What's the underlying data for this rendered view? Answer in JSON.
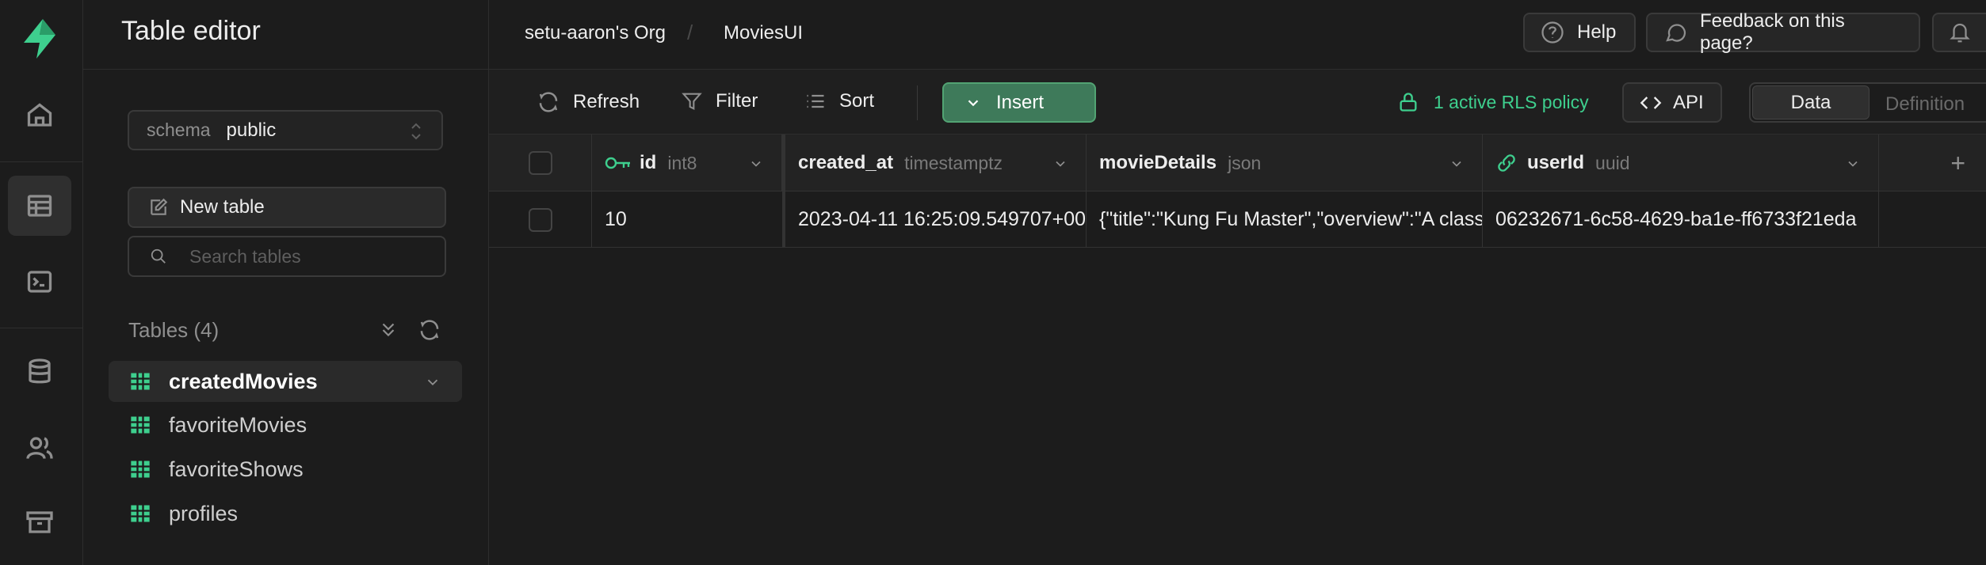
{
  "sidebar": {
    "title": "Table editor",
    "schema_label": "schema",
    "schema_value": "public",
    "new_table_label": "New table",
    "search_placeholder": "Search tables",
    "tables_header": "Tables (4)",
    "tables": [
      {
        "name": "createdMovies",
        "active": true
      },
      {
        "name": "favoriteMovies",
        "active": false
      },
      {
        "name": "favoriteShows",
        "active": false
      },
      {
        "name": "profiles",
        "active": false
      }
    ]
  },
  "header": {
    "org": "setu-aaron's Org",
    "separator": "/",
    "project": "MoviesUI",
    "help_label": "Help",
    "feedback_label": "Feedback on this page?"
  },
  "toolbar": {
    "refresh_label": "Refresh",
    "filter_label": "Filter",
    "sort_label": "Sort",
    "insert_label": "Insert",
    "rls_label": "1 active RLS policy",
    "api_label": "API",
    "view_data_label": "Data",
    "view_definition_label": "Definition"
  },
  "grid": {
    "columns": [
      {
        "name": "id",
        "type": "int8",
        "icon": "key-icon"
      },
      {
        "name": "created_at",
        "type": "timestamptz"
      },
      {
        "name": "movieDetails",
        "type": "json"
      },
      {
        "name": "userId",
        "type": "uuid",
        "icon": "link-icon"
      }
    ],
    "add_column_label": "+",
    "rows": [
      {
        "id": "10",
        "created_at": "2023-04-11 16:25:09.549707+00",
        "movieDetails": "{\"title\":\"Kung Fu Master\",\"overview\":\"A classic",
        "userId": "06232671-6c58-4629-ba1e-ff6733f21eda"
      }
    ]
  },
  "colors": {
    "brand": "#3ecf8e",
    "insert_bg": "#3e7a5a",
    "background": "#1c1c1c"
  }
}
